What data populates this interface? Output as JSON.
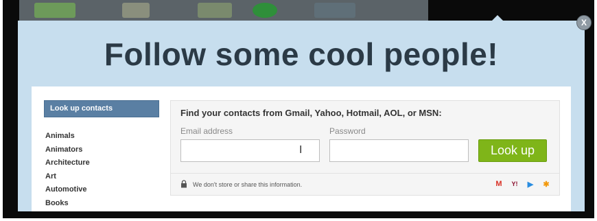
{
  "modal": {
    "close_label": "X",
    "headline": "Follow some cool people!"
  },
  "sidebar": {
    "header": "Look up contacts",
    "categories": [
      "Animals",
      "Animators",
      "Architecture",
      "Art",
      "Automotive",
      "Books"
    ]
  },
  "lookup": {
    "title": "Find your contacts from Gmail, Yahoo, Hotmail, AOL, or MSN:",
    "email_label": "Email address",
    "password_label": "Password",
    "button_label": "Look up",
    "privacy_note": "We don't store or share this information."
  },
  "providers": [
    {
      "name": "gmail-icon",
      "glyph": "M",
      "color": "#d93025"
    },
    {
      "name": "yahoo-icon",
      "glyph": "Y!",
      "color": "#8a0f2e"
    },
    {
      "name": "aol-icon",
      "glyph": "▶",
      "color": "#2a8de0"
    },
    {
      "name": "msn-icon",
      "glyph": "✱",
      "color": "#f29a0f"
    }
  ],
  "colors": {
    "modal_bg": "#c7deee",
    "button_green": "#7fb519",
    "sidebar_header": "#5a7fa3"
  }
}
